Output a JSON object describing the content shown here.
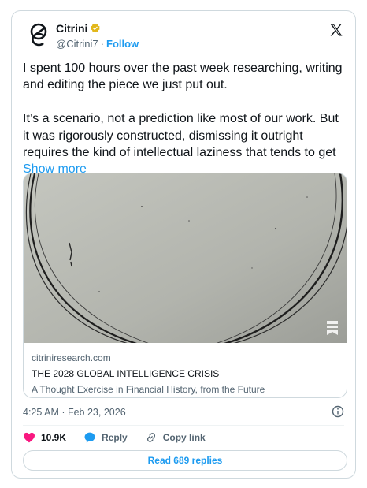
{
  "author": {
    "display_name": "Citrini",
    "handle": "@Citrini7",
    "separator": "·",
    "follow_label": "Follow",
    "verified_color": "#e2b719"
  },
  "tweet": {
    "text": "I spent 100 hours over the past week researching, writing and editing the piece we just put out.\n\nIt’s a scenario, not a prediction like most of our work. But it was rigorously constructed, dismissing it outright requires the kind of intellectual laziness that tends to get ",
    "show_more_label": "Show more",
    "timestamp": "4:25 AM · Feb 23, 2026"
  },
  "link_card": {
    "domain": "citriniresearch.com",
    "title": "THE 2028 GLOBAL INTELLIGENCE CRISIS",
    "description": "A Thought Exercise in Financial History, from the Future"
  },
  "actions": {
    "likes": "10.9K",
    "reply_label": "Reply",
    "copy_link_label": "Copy link"
  },
  "replies_button_label": "Read 689 replies",
  "colors": {
    "accent": "#1d9bf0",
    "like_heart": "#f91880",
    "text": "#0f1419",
    "secondary_text": "#536471",
    "border": "#cfd9de"
  }
}
